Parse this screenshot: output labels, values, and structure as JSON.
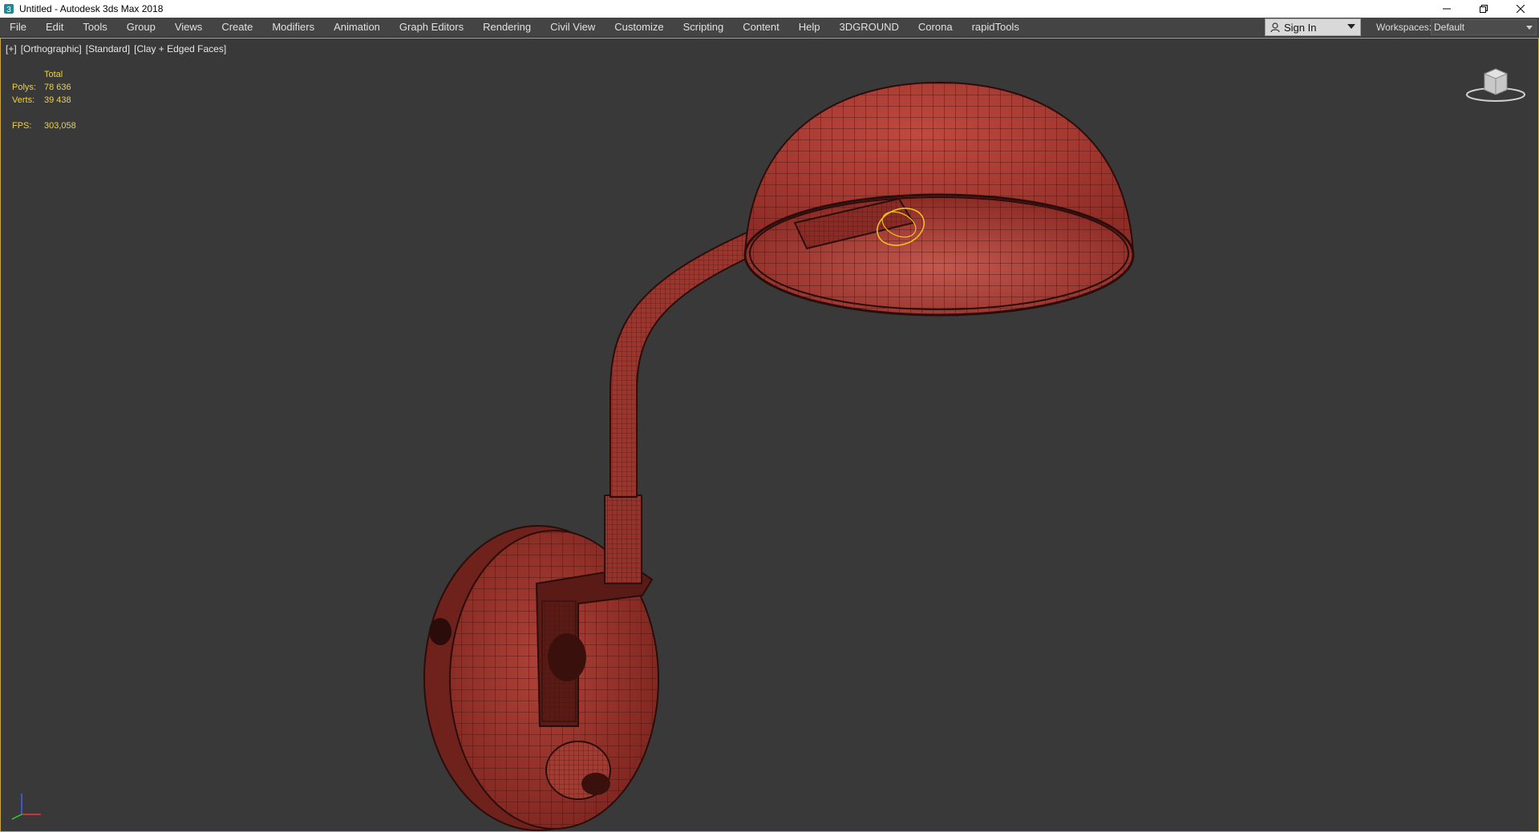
{
  "window": {
    "title": "Untitled - Autodesk 3ds Max 2018",
    "icon": "3dsmax-app-icon",
    "controls": [
      "minimize-icon",
      "restore-icon",
      "close-icon"
    ]
  },
  "menubar": {
    "items": [
      "File",
      "Edit",
      "Tools",
      "Group",
      "Views",
      "Create",
      "Modifiers",
      "Animation",
      "Graph Editors",
      "Rendering",
      "Civil View",
      "Customize",
      "Scripting",
      "Content",
      "Help",
      "3DGROUND",
      "Corona",
      "rapidTools"
    ]
  },
  "signin": {
    "label": "Sign In",
    "icon": "user-icon"
  },
  "workspaces": {
    "label": "Workspaces:",
    "value": "Default"
  },
  "viewport": {
    "labels": [
      "[+]",
      "[Orthographic]",
      "[Standard]",
      "[Clay + Edged Faces]"
    ],
    "stats": {
      "header": "Total",
      "rows": [
        {
          "label": "Polys:",
          "value": "78 636"
        },
        {
          "label": "Verts:",
          "value": "39 438"
        }
      ],
      "fps_label": "FPS:",
      "fps_value": "303,058"
    },
    "model_color": "#a63a32",
    "selection_color": "#f0c020"
  },
  "colors": {
    "menubar_bg": "#444444",
    "viewport_bg": "#393939",
    "viewport_border": "#c9a54a",
    "stats_text": "#f0d23a"
  }
}
